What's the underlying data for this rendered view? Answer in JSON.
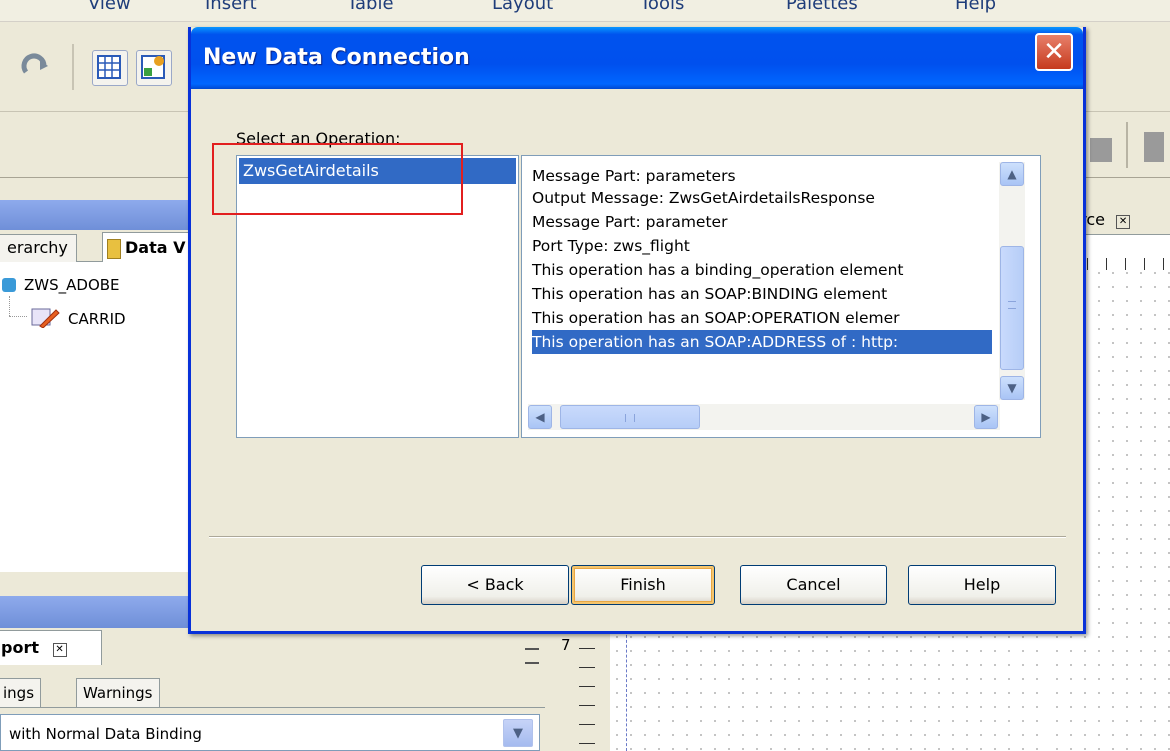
{
  "menubar": {
    "items": [
      "View",
      "Insert",
      "Table",
      "Layout",
      "Tools",
      "Palettes",
      "Help"
    ]
  },
  "panel1": {
    "tabs": {
      "hierarchy": "erarchy",
      "data_view": "Data V"
    },
    "tree": {
      "root": "ZWS_ADOBE",
      "child": "CARRID"
    }
  },
  "report": {
    "tab_label": "port",
    "subtabs": [
      "ings",
      "Warnings"
    ],
    "binding_value": "with Normal Data Binding"
  },
  "right_panel": {
    "source_tab": "urce",
    "ruler_mark": "7"
  },
  "dialog": {
    "title": "New Data Connection",
    "close_label": "✕",
    "operation_label": "Select an Operation:",
    "operations": [
      "ZwsGetAirdetails"
    ],
    "selected_operation": "ZwsGetAirdetails",
    "details": [
      "Message Part: parameters",
      "Output Message: ZwsGetAirdetailsResponse",
      "Message Part: parameter",
      "Port Type: zws_flight",
      "This operation has a binding_operation element",
      "This operation has an SOAP:BINDING element",
      "This operation has an SOAP:OPERATION elemer",
      "This operation has an SOAP:ADDRESS of : http:"
    ],
    "selected_detail_index": 7,
    "buttons": {
      "back": "< Back",
      "finish": "Finish",
      "cancel": "Cancel",
      "help": "Help"
    }
  },
  "colors": {
    "titlebar": "#0054e3",
    "selection": "#316ac5",
    "highlight_box": "#e21f1f",
    "dialog_bg": "#ece9d8"
  }
}
